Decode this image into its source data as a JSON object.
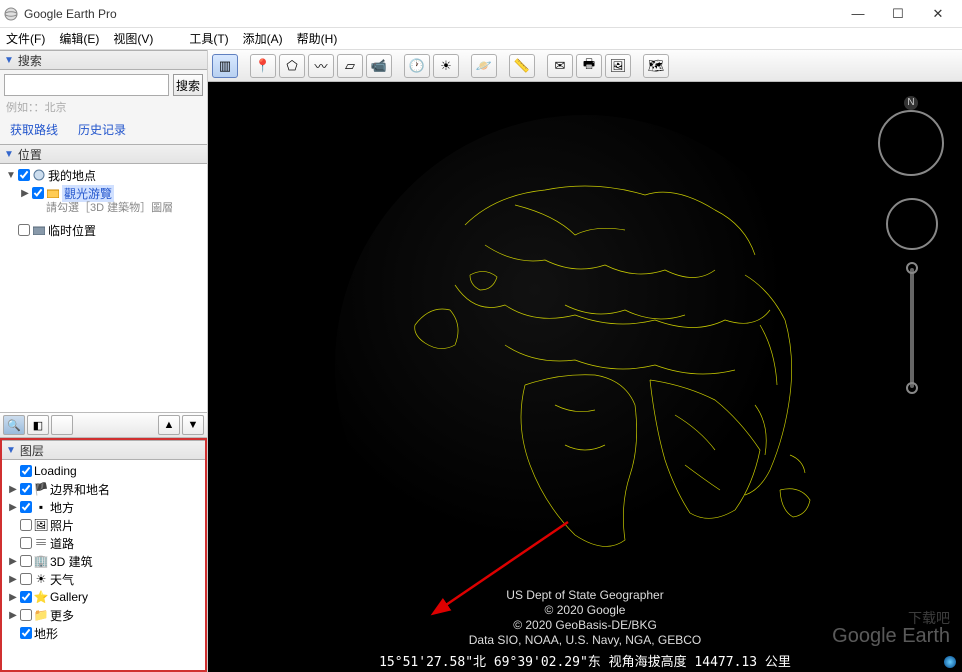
{
  "window": {
    "title": "Google Earth Pro"
  },
  "menu": {
    "file": "文件(F)",
    "edit": "编辑(E)",
    "view": "视图(V)",
    "tools": "工具(T)",
    "add": "添加(A)",
    "help": "帮助(H)"
  },
  "search": {
    "header": "搜索",
    "button": "搜索",
    "placeholder": "",
    "hint": "例如：：北京",
    "routes": "获取路线",
    "history": "历史记录"
  },
  "places": {
    "header": "位置",
    "items": [
      {
        "label": "我的地点",
        "checked": true,
        "arrow": "▼"
      },
      {
        "label": "觀光游覽",
        "checked": true,
        "arrow": "▶",
        "highlight": true
      },
      {
        "sub": "請勾選［3D 建築物］圖層"
      },
      {
        "label": "临时位置",
        "checked": false,
        "arrow": ""
      }
    ]
  },
  "layers": {
    "header": "图层",
    "items": [
      {
        "label": "Loading",
        "checked": true,
        "arrow": "",
        "icon": ""
      },
      {
        "label": "边界和地名",
        "checked": true,
        "arrow": "▶",
        "icon": "flag"
      },
      {
        "label": "地方",
        "checked": true,
        "arrow": "▶",
        "icon": "square"
      },
      {
        "label": "照片",
        "checked": false,
        "arrow": "",
        "icon": "photo"
      },
      {
        "label": "道路",
        "checked": false,
        "arrow": "",
        "icon": "road"
      },
      {
        "label": "3D 建筑",
        "checked": false,
        "arrow": "▶",
        "icon": "building"
      },
      {
        "label": "天气",
        "checked": false,
        "arrow": "▶",
        "icon": "sun"
      },
      {
        "label": "Gallery",
        "checked": true,
        "arrow": "▶",
        "icon": "star"
      },
      {
        "label": "更多",
        "checked": false,
        "arrow": "▶",
        "icon": "folder"
      },
      {
        "label": "地形",
        "checked": true,
        "arrow": "",
        "icon": ""
      }
    ]
  },
  "attribution": {
    "l1": "US Dept of State Geographer",
    "l2": "© 2020 Google",
    "l3": "© 2020 GeoBasis-DE/BKG",
    "l4": "Data SIO, NOAA, U.S. Navy, NGA, GEBCO"
  },
  "status": {
    "text": "15°51'27.58\"北  69°39'02.29\"东 视角海拔高度 14477.13 公里"
  },
  "watermark": {
    "main": "Google Earth",
    "overlay": "下载吧"
  },
  "compass": {
    "north": "N"
  }
}
